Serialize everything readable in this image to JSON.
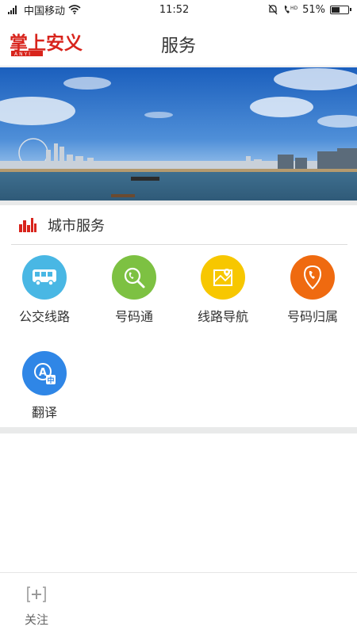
{
  "status_bar": {
    "carrier": "中国移动",
    "time": "11:52",
    "battery": "51%",
    "battery_level": 0.51
  },
  "header": {
    "logo_text": "掌上安义",
    "logo_subtext": "ANYI",
    "title": "服务"
  },
  "section": {
    "title": "城市服务"
  },
  "services": [
    {
      "label": "公交线路",
      "icon": "bus-icon",
      "color": "#49b7e4"
    },
    {
      "label": "号码通",
      "icon": "phone-search-icon",
      "color": "#7dc142"
    },
    {
      "label": "线路导航",
      "icon": "map-icon",
      "color": "#f7c700"
    },
    {
      "label": "号码归属",
      "icon": "phone-location-icon",
      "color": "#ef6a10"
    },
    {
      "label": "翻译",
      "icon": "translate-icon",
      "color": "#2f86e6"
    }
  ],
  "tabbar": {
    "follow_label": "关注"
  },
  "colors": {
    "brand_red": "#d8241c",
    "divider": "#e9eaea"
  }
}
